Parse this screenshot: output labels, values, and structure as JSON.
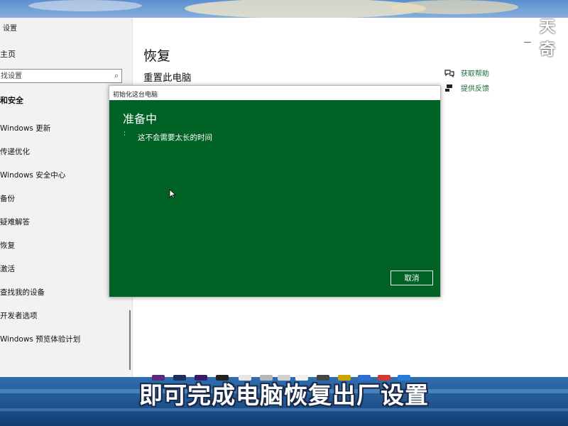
{
  "window": {
    "title": "设置"
  },
  "sidebar": {
    "home": "主页",
    "search_placeholder": "找设置",
    "section": "和安全",
    "items": [
      {
        "label": "Windows 更新"
      },
      {
        "label": "传递优化"
      },
      {
        "label": "Windows 安全中心"
      },
      {
        "label": "备份"
      },
      {
        "label": "疑难解答"
      },
      {
        "label": "恢复"
      },
      {
        "label": "激活"
      },
      {
        "label": "查找我的设备"
      },
      {
        "label": "开发者选项"
      },
      {
        "label": "Windows 预览体验计划"
      }
    ]
  },
  "main": {
    "title": "恢复",
    "subtitle": "重置此电脑",
    "help": [
      {
        "label": "获取帮助",
        "icon": "chat-help-icon"
      },
      {
        "label": "提供反馈",
        "icon": "feedback-icon"
      }
    ]
  },
  "dialog": {
    "title": "初始化这台电脑",
    "heading": "准备中",
    "message": "这不会需要太长的时间",
    "cancel_label": "取消",
    "background_color": "#006225"
  },
  "overlay": {
    "logo": "天奇",
    "caption": "即可完成电脑恢复出厂设置"
  },
  "colors": {
    "link": "#1a6e3a",
    "dialog_green": "#006225"
  }
}
